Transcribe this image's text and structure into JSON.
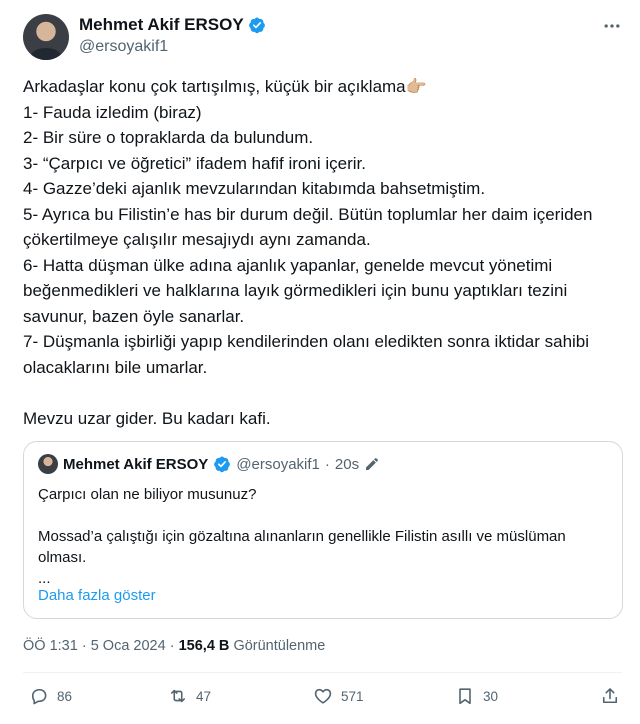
{
  "author": {
    "name": "Mehmet Akif ERSOY",
    "handle": "@ersoyakif1",
    "verified_color": "#1d9bf0"
  },
  "menu_icon": "more-dots-icon",
  "tweet": {
    "text": "Arkadaşlar konu çok tartışılmış, küçük bir açıklama👉🏼\n1- Fauda izledim (biraz)\n2- Bir süre o topraklarda da bulundum.\n3- “Çarpıcı ve öğretici” ifadem hafif ironi içerir.\n4- Gazze’deki ajanlık mevzularından kitabımda bahsetmiştim.\n5- Ayrıca bu Filistin’e has bir durum değil. Bütün toplumlar her daim içeriden çökertilmeye çalışılır mesajıydı aynı zamanda.\n6- Hatta düşman ülke adına ajanlık yapanlar, genelde mevcut yönetimi beğenmedikleri ve halklarına layık görmedikleri için bunu yaptıkları tezini savunur, bazen öyle sanarlar.\n7- Düşmanla işbirliği yapıp kendilerinden olanı eledikten sonra iktidar sahibi olacaklarını bile umarlar.\n\nMevzu uzar gider. Bu kadarı kafi."
  },
  "quote": {
    "name": "Mehmet Akif ERSOY",
    "handle": "@ersoyakif1",
    "separator": "·",
    "time": "20s",
    "edit_icon": "edit-pencil-icon",
    "text": "Çarpıcı olan ne biliyor musunuz?\n\nMossad’a çalıştığı için gözaltına alınanların genellikle Filistin asıllı ve müslüman olması.\n...",
    "show_more": "Daha fazla göster"
  },
  "meta": {
    "time": "ÖÖ 1:31",
    "separator": "·",
    "date": "5 Oca 2024",
    "views_count": "156,4 B",
    "views_label": "Görüntülenme"
  },
  "actions": {
    "replies": "86",
    "reposts": "47",
    "likes": "571",
    "bookmarks": "30"
  }
}
